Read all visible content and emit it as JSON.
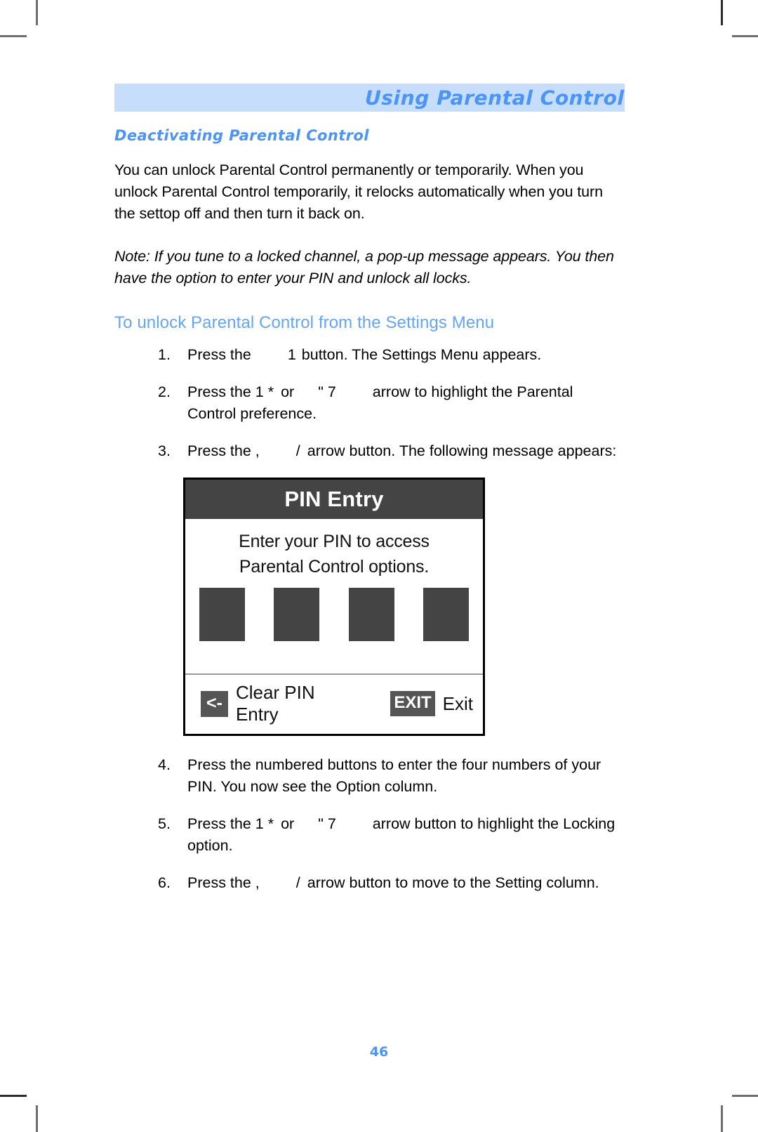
{
  "header": {
    "running_title": "Using Parental Control"
  },
  "section": {
    "heading": "Deactivating Parental Control",
    "intro_paragraph": "You can unlock Parental Control permanently or temporarily. When you unlock Parental Control temporarily, it relocks automatically when you turn the settop off and then turn it back on.",
    "note_paragraph": "Note:  If you tune to a locked channel, a pop-up message appears. You then have the option to enter your PIN and unlock all locks.",
    "subheading": "To unlock Parental Control from the Settings Menu"
  },
  "steps": [
    {
      "number": "1.",
      "part_a": "Press the",
      "glyph_1": "1",
      "part_b": "button. The Settings Menu appears.",
      "glyph_2": "",
      "part_c": ""
    },
    {
      "number": "2.",
      "part_a": "Press the  1 *",
      "glyph_1": "or",
      "part_b": "\" 7",
      "glyph_2": "",
      "part_c": "arrow to highlight the Parental Control preference."
    },
    {
      "number": "3.",
      "part_a": "Press the  ,",
      "glyph_1": "/",
      "part_b": "arrow button. The following message appears:",
      "glyph_2": "",
      "part_c": ""
    },
    {
      "number": "4.",
      "part_a": "Press the numbered buttons to enter the four numbers of your PIN. You now see the Option column.",
      "glyph_1": "",
      "part_b": "",
      "glyph_2": "",
      "part_c": ""
    },
    {
      "number": "5.",
      "part_a": "Press the  1 *",
      "glyph_1": "or",
      "part_b": "\" 7",
      "glyph_2": "",
      "part_c": "arrow button to highlight the Locking option."
    },
    {
      "number": "6.",
      "part_a": "Press the  ,",
      "glyph_1": "/",
      "part_b": "arrow button to move to the Setting column.",
      "glyph_2": "",
      "part_c": ""
    }
  ],
  "pin_dialog": {
    "title": "PIN Entry",
    "prompt_line_1": "Enter your PIN to access",
    "prompt_line_2": "Parental Control options.",
    "entry_boxes": [
      "",
      "",
      "",
      ""
    ],
    "clear_key_glyph": "<-",
    "clear_label": "Clear PIN Entry",
    "exit_key_glyph": "EXIT",
    "exit_label": "Exit"
  },
  "footer": {
    "page_number": "46"
  },
  "colors": {
    "header_bar_bg": "#c6ddfc",
    "header_title": "#4d94f7",
    "section_heading": "#4d94f7",
    "subheading": "#64a6f5",
    "dialog_dark": "#444444",
    "page_number": "#4d94f7"
  }
}
